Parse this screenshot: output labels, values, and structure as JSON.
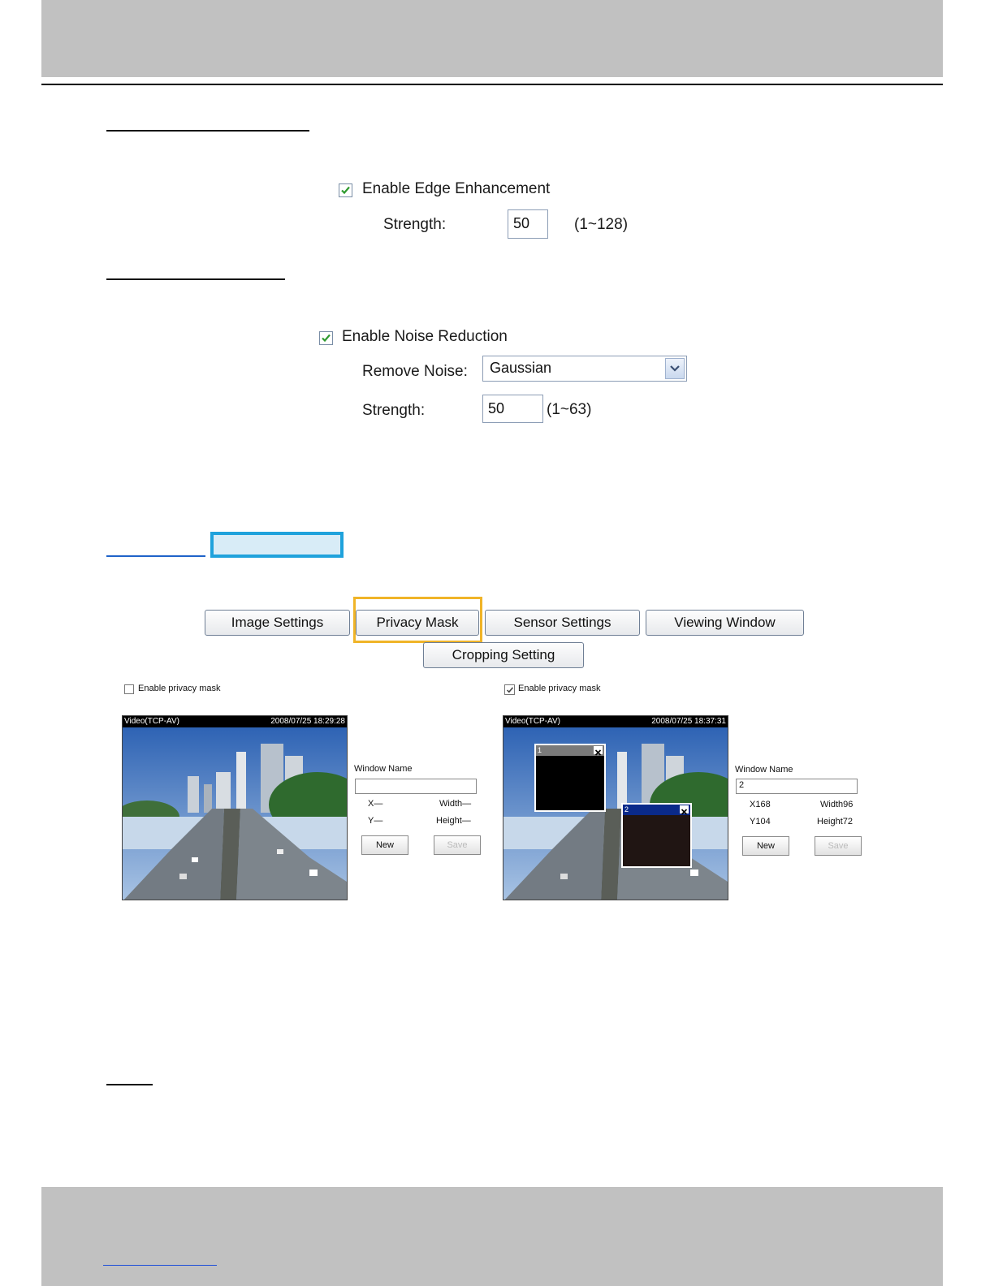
{
  "edge": {
    "checkbox_label": "Enable Edge Enhancement",
    "strength_label": "Strength:",
    "strength_value": "50",
    "strength_range": "(1~128)"
  },
  "noise": {
    "checkbox_label": "Enable Noise Reduction",
    "remove_noise_label": "Remove Noise:",
    "remove_noise_value": "Gaussian",
    "strength_label": "Strength:",
    "strength_value": "50",
    "strength_range": "(1~63)"
  },
  "tabs": {
    "image_settings": "Image Settings",
    "privacy_mask": "Privacy Mask",
    "sensor_settings": "Sensor Settings",
    "viewing_window": "Viewing Window",
    "cropping_setting": "Cropping Setting"
  },
  "left_panel": {
    "enable_label": "Enable privacy mask",
    "video_title": "Video(TCP-AV)",
    "timestamp": "2008/07/25 18:29:28",
    "window_name_label": "Window Name",
    "window_name_value": "",
    "x_label": "X—",
    "y_label": "Y—",
    "width_label": "Width—",
    "height_label": "Height—",
    "new_label": "New",
    "save_label": "Save"
  },
  "right_panel": {
    "enable_label": "Enable privacy mask",
    "video_title": "Video(TCP-AV)",
    "timestamp": "2008/07/25 18:37:31",
    "window_name_label": "Window Name",
    "window_name_value": "2",
    "x_label": "X168",
    "y_label": "Y104",
    "width_label": "Width96",
    "height_label": "Height72",
    "new_label": "New",
    "save_label": "Save",
    "mask1_label": "1",
    "mask2_label": "2"
  },
  "colors": {
    "header_bar": "#c1c1c1",
    "highlight_blue": "#1fa2dc",
    "highlight_orange": "#f0b428",
    "checkbox_check": "#2e9a2e"
  },
  "icons": {
    "check": "check-icon",
    "dropdown": "chevron-down-icon",
    "close": "close-icon"
  }
}
